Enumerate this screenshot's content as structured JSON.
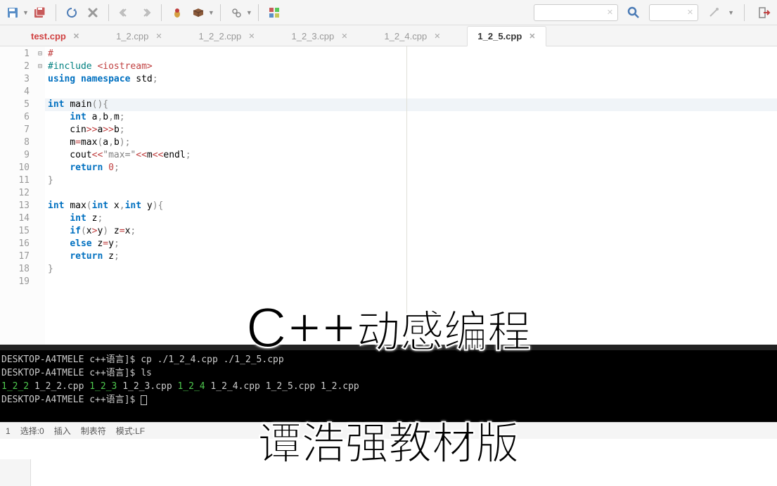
{
  "toolbar": {
    "icons": [
      "save",
      "save-all",
      "refresh",
      "stop",
      "back",
      "forward",
      "bug",
      "brick",
      "gear",
      "palette",
      "search-clear",
      "search",
      "search-clear2",
      "wand",
      "exit"
    ]
  },
  "tabs": [
    {
      "label": "test.cpp",
      "modified": true,
      "active": false
    },
    {
      "label": "1_2.cpp",
      "modified": false,
      "active": false
    },
    {
      "label": "1_2_2.cpp",
      "modified": false,
      "active": false
    },
    {
      "label": "1_2_3.cpp",
      "modified": false,
      "active": false
    },
    {
      "label": "1_2_4.cpp",
      "modified": false,
      "active": false
    },
    {
      "label": "1_2_5.cpp",
      "modified": false,
      "active": true
    }
  ],
  "code": {
    "lines": [
      {
        "n": 1,
        "html": "<span class='op'>#</span>"
      },
      {
        "n": 2,
        "html": "<span class='pp'>#include</span> <span class='inc'>&lt;iostream&gt;</span>"
      },
      {
        "n": 3,
        "html": "<span class='kw'>using</span> <span class='kw'>namespace</span> std<span class='punc'>;</span>"
      },
      {
        "n": 4,
        "html": ""
      },
      {
        "n": 5,
        "fold": "⊟",
        "hl": true,
        "html": "<span class='kw'>int</span> <span class='fn'>main</span><span class='punc'>(){</span>"
      },
      {
        "n": 6,
        "html": "    <span class='kw'>int</span> a<span class='punc'>,</span>b<span class='punc'>,</span>m<span class='punc'>;</span>"
      },
      {
        "n": 7,
        "html": "    cin<span class='op'>&gt;&gt;</span>a<span class='op'>&gt;&gt;</span>b<span class='punc'>;</span>"
      },
      {
        "n": 8,
        "html": "    m<span class='op'>=</span>max<span class='punc'>(</span>a<span class='punc'>,</span>b<span class='punc'>);</span>"
      },
      {
        "n": 9,
        "html": "    cout<span class='op'>&lt;&lt;</span><span class='str'>\"max=\"</span><span class='op'>&lt;&lt;</span>m<span class='op'>&lt;&lt;</span>endl<span class='punc'>;</span>"
      },
      {
        "n": 10,
        "html": "    <span class='kw'>return</span> <span class='num'>0</span><span class='punc'>;</span>"
      },
      {
        "n": 11,
        "html": "<span class='punc'>}</span>"
      },
      {
        "n": 12,
        "html": ""
      },
      {
        "n": 13,
        "fold": "⊟",
        "html": "<span class='kw'>int</span> <span class='fn'>max</span><span class='punc'>(</span><span class='kw'>int</span> x<span class='punc'>,</span><span class='kw'>int</span> y<span class='punc'>){</span>"
      },
      {
        "n": 14,
        "html": "    <span class='kw'>int</span> z<span class='punc'>;</span>"
      },
      {
        "n": 15,
        "html": "    <span class='kw'>if</span><span class='punc'>(</span>x<span class='op'>&gt;</span>y<span class='punc'>)</span> z<span class='op'>=</span>x<span class='punc'>;</span>"
      },
      {
        "n": 16,
        "html": "    <span class='kw'>else</span> z<span class='op'>=</span>y<span class='punc'>;</span>"
      },
      {
        "n": 17,
        "html": "    <span class='kw'>return</span> z<span class='punc'>;</span>"
      },
      {
        "n": 18,
        "html": "<span class='punc'>}</span>"
      },
      {
        "n": 19,
        "html": ""
      }
    ]
  },
  "terminal": {
    "lines": [
      {
        "prompt": "DESKTOP-A4TMELE c++语言]$",
        "cmd": " cp ./1_2_4.cpp ./1_2_5.cpp"
      },
      {
        "prompt": "DESKTOP-A4TMELE c++语言]$",
        "cmd": " ls"
      },
      {
        "files": [
          {
            "t": "1_2_2",
            "c": "green"
          },
          {
            "t": "  1_2_2.cpp  ",
            "c": ""
          },
          {
            "t": "1_2_3",
            "c": "green"
          },
          {
            "t": "  1_2_3.cpp  ",
            "c": ""
          },
          {
            "t": "1_2_4",
            "c": "green"
          },
          {
            "t": "  1_2_4.cpp  1_2_5.cpp  1_2.cpp",
            "c": ""
          }
        ]
      },
      {
        "prompt": "DESKTOP-A4TMELE c++语言]$",
        "cursor": true
      }
    ]
  },
  "statusbar": {
    "line": "1",
    "select": "选择:0",
    "insert": "插入",
    "tab": "制表符",
    "mode": "模式:LF",
    "rest": ""
  },
  "overlay": {
    "line1_big": "C++",
    "line1_rest": "动感编程",
    "line2": "谭浩强教材版"
  }
}
